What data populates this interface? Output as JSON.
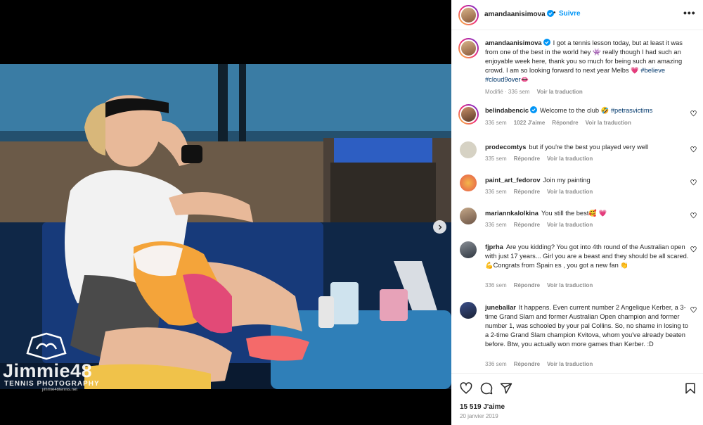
{
  "post": {
    "author": "amandaanisimova",
    "follow_label": "Suivre",
    "separator": "•",
    "more_label": "•••",
    "next_label": "›"
  },
  "watermark": {
    "name": "Jimmie48",
    "sub": "TENNIS PHOTOGRAPHY",
    "url": "jimmie48tennis.net"
  },
  "caption": {
    "user": "amandaanisimova",
    "text": "I got a tennis lesson today, but at least it was from one of the best in the world hey 👾 really though I had such an enjoyable week here, thank you so much for being such an amazing crowd. I am so looking forward to next year Melbs 💗",
    "tags": "#believe #cloud9over👄",
    "edited": "Modifié · 336 sem",
    "translate": "Voir la traduction"
  },
  "comments": [
    {
      "user": "belindabencic",
      "text": "Welcome to the club 🤣",
      "tag": "#petrasvictims",
      "age": "336 sem",
      "likes": "1022 J'aime",
      "reply": "Répondre",
      "translate": "Voir la traduction"
    },
    {
      "user": "prodecomtys",
      "text": "but if you're the best you played very well",
      "age": "335 sem",
      "reply": "Répondre",
      "translate": "Voir la traduction"
    },
    {
      "user": "paint_art_fedorov",
      "text": "Join my painting",
      "age": "336 sem",
      "reply": "Répondre",
      "translate": "Voir la traduction"
    },
    {
      "user": "mariannkalolkina",
      "text": "You still the best🥰 💗",
      "age": "336 sem",
      "reply": "Répondre",
      "translate": "Voir la traduction"
    },
    {
      "user": "fjprha",
      "text": "Are you kidding? You got into 4th round of the Australian open with just 17 years... Girl you are a beast and they should be all scared.💪Congrats from Spain ᴇs , you got a new fan 👏",
      "age": "336 sem",
      "reply": "Répondre",
      "translate": "Voir la traduction"
    },
    {
      "user": "juneballar",
      "text": "It happens. Even current number 2 Angelique Kerber, a 3-time Grand Slam and former Australian Open champion and former number 1, was schooled by your pal Collins. So, no shame in losing to a 2-time Grand Slam champion Kvitova, whom you've already beaten before. Btw, you actually won more games than Kerber. :D",
      "age": "336 sem",
      "reply": "Répondre",
      "translate": "Voir la traduction"
    }
  ],
  "footer": {
    "likes": "15 519 J'aime",
    "date": "20 janvier 2019"
  },
  "colors": {
    "accent": "#0095f6",
    "muted": "#8e8e8e",
    "tag": "#00376b"
  }
}
